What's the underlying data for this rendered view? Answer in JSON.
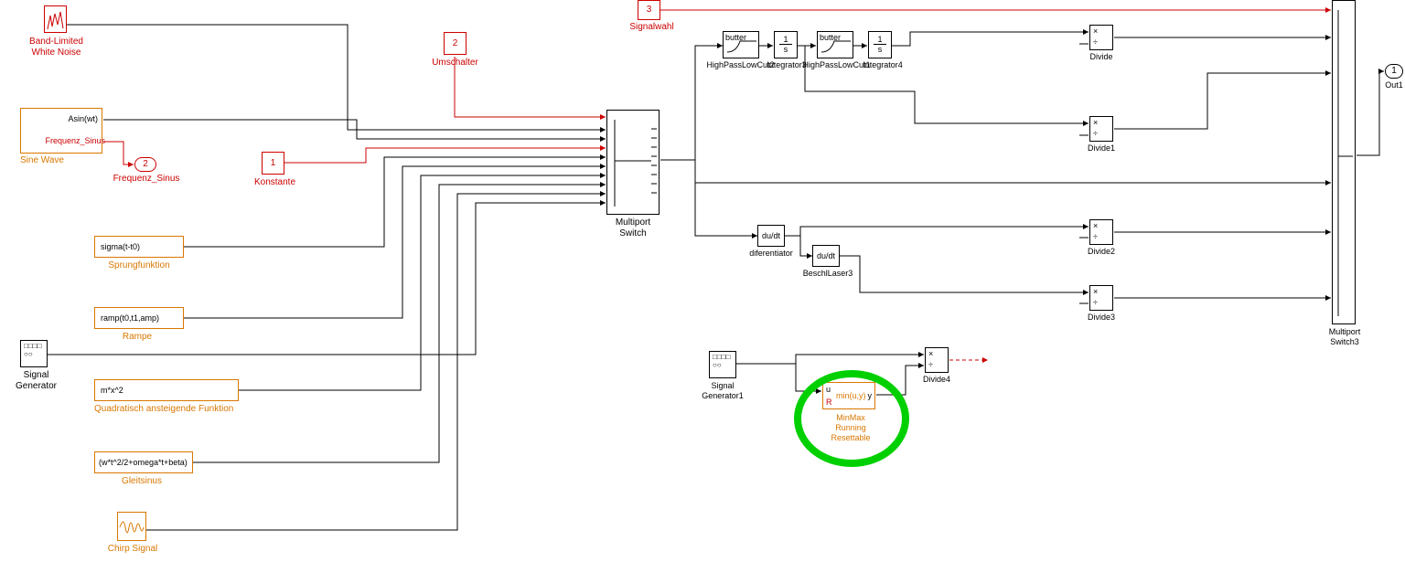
{
  "blocks": {
    "bandNoise": "Band-Limited\nWhite Noise",
    "umschalter": "Umschalter",
    "umschalterNum": "2",
    "signalwahl": "Signalwahl",
    "signalwahlNum": "3",
    "sineWave": "Sine Wave",
    "freqSinus": "Frequenz_Sinus",
    "freqSinusPort": "2",
    "asin": "Asin(wt)",
    "konstante": "Konstante",
    "konstanteNum": "1",
    "sprung": "Sprungfunktion",
    "sprungExpr": "sigma(t-t0)",
    "rampe": "Rampe",
    "rampeExpr": "ramp(t0,t1,amp)",
    "quad": "Quadratisch ansteigende Funktion",
    "quadExpr": "m*x^2",
    "gleit": "Gleitsinus",
    "gleitExpr": "(w*t^2/2+omega*t+beta)",
    "chirp": "Chirp Signal",
    "sigGen": "Signal\nGenerator",
    "sigGen1": "Signal\nGenerator1",
    "mswitch": "Multiport\nSwitch",
    "mswitch3": "Multiport\nSwitch3",
    "hplc1": "HighPassLowCut2",
    "hplc2": "HighPassLowCut1",
    "integ3": "Integrator3",
    "integ4": "Integrator4",
    "integSym": "1\ns",
    "butter": "butter",
    "divide": "Divide",
    "divide1": "Divide1",
    "divide2": "Divide2",
    "divide3": "Divide3",
    "divide4": "Divide4",
    "diff": "diferentiator",
    "diffSym": "du/dt",
    "beschl": "BeschlLaser3",
    "minmax": "MinMax\nRunning\nResettable",
    "minmaxFn": "min(u,y)",
    "minmaxU": "u",
    "minmaxR": "R",
    "minmaxY": "y",
    "out1": "Out1",
    "out1Num": "1"
  },
  "annotation": {
    "highlight": "green-circle"
  }
}
